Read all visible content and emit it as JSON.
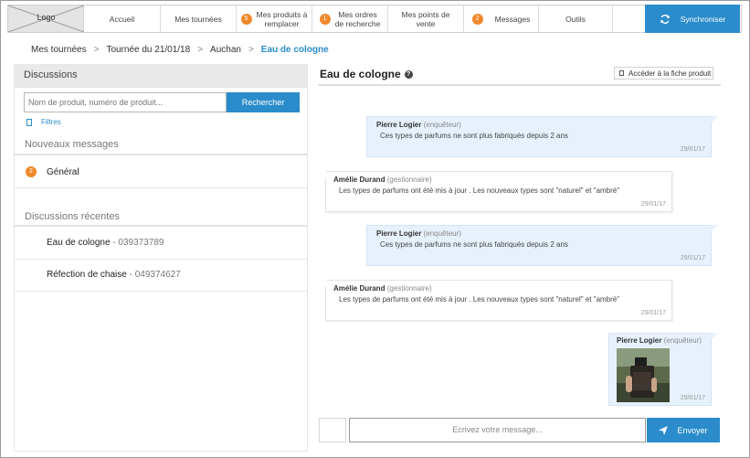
{
  "nav": {
    "logo": "Logo",
    "items": [
      {
        "label": "Accueil",
        "badge": ""
      },
      {
        "label": "Mes tournées",
        "badge": ""
      },
      {
        "label": "Mes produits à remplacer",
        "badge": "5"
      },
      {
        "label": "Mes ordres de recherche",
        "badge": "1"
      },
      {
        "label": "Mes points de vente",
        "badge": ""
      },
      {
        "label": "Messages",
        "badge": "2"
      },
      {
        "label": "Outils",
        "badge": ""
      }
    ],
    "sync_label": "Synchroniser"
  },
  "breadcrumb": {
    "items": [
      "Mes tournées",
      "Tournée du 21/01/18",
      "Auchan"
    ],
    "separator": ">",
    "current": "Eau de cologne"
  },
  "left": {
    "header": "Discussions",
    "search_placeholder": "Nom de produit, numéro de produit...",
    "search_button": "Rechercher",
    "filters": "Filtres",
    "new_messages_title": "Nouveaux messages",
    "general": {
      "badge": "2",
      "label": "Général"
    },
    "recent_title": "Discussions récentes",
    "recent": [
      {
        "name": "Eau de cologne",
        "number": "- 039373789"
      },
      {
        "name": "Réfection de chaise",
        "number": "- 049374627"
      }
    ]
  },
  "right": {
    "title": "Eau de cologne",
    "help_icon": "?",
    "product_link": "Accéder à la fiche produit",
    "messages": [
      {
        "side": "right",
        "author": "Pierre Logier",
        "role": "(enquêteur)",
        "text": "Ces types de parfums ne sont plus fabriqués depuis 2 ans",
        "date": "29/01/17"
      },
      {
        "side": "left",
        "author": "Amélie Durand",
        "role": "(gestionnaire)",
        "text": "Les types de parfums ont été mis à jour . Les nouveaux types sont \"naturel\" et \"ambré\"",
        "date": "29/01/17"
      },
      {
        "side": "right",
        "author": "Pierre Logier",
        "role": "(enquêteur)",
        "text": "Ces types de parfums ne sont plus fabriqués depuis 2 ans",
        "date": "29/01/17"
      },
      {
        "side": "left",
        "author": "Amélie Durand",
        "role": "(gestionnaire)",
        "text": "Les types de parfums ont été mis à jour . Les nouveaux types sont \"naturel\" et \"ambré\"",
        "date": "29/01/17"
      },
      {
        "side": "right",
        "author": "Pierre Logier",
        "role": "(enquêteur)",
        "text": "",
        "date": "29/01/17",
        "has_photo": true
      }
    ],
    "composer_placeholder": "Ecrivez votre message...",
    "send_label": "Envoyer"
  },
  "colors": {
    "accent": "#2a8ccb",
    "badge": "#f0882a",
    "bubble_right": "#e7f1fd"
  }
}
